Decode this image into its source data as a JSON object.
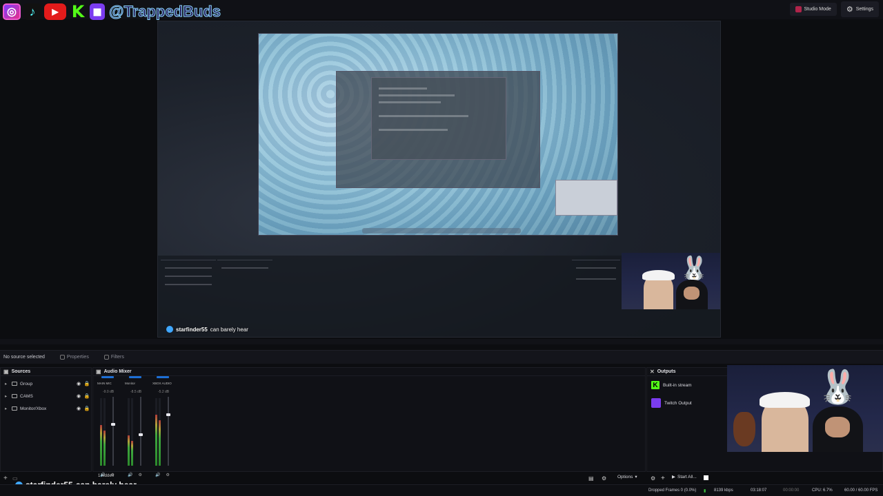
{
  "topbar": {
    "handle": "@TrappedBuds",
    "tiktok_icon": "tiktok-icon",
    "social_icons": [
      "instagram-icon",
      "tiktok-icon",
      "youtube-icon",
      "kick-icon",
      "twitch-icon"
    ],
    "studio_mode_label": "Studio Mode",
    "settings_label": "Settings"
  },
  "preview": {
    "chat_user": "starfinder55",
    "chat_text": "can barely hear"
  },
  "selection_bar": {
    "no_source": "No source selected",
    "properties": "Properties",
    "filters": "Filters"
  },
  "sources": {
    "title": "Sources",
    "items": [
      {
        "label": "Group"
      },
      {
        "label": "CAMS"
      },
      {
        "label": "Monitor/Xbox"
      }
    ]
  },
  "mixer": {
    "title": "Audio Mixer",
    "channels": [
      {
        "name": "MAIN MIC",
        "db": "-9.0 dB",
        "level": 0.6
      },
      {
        "name": "Monitor",
        "db": "-8.5 dB",
        "level": 0.45
      },
      {
        "name": "XBOX AUDIO",
        "db": "-5.2 dB",
        "level": 0.75
      }
    ],
    "hidden_label": "1 hidden"
  },
  "outputs": {
    "title": "Outputs",
    "items": [
      {
        "label": "Built-in stream"
      },
      {
        "label": "Twitch Output"
      }
    ]
  },
  "controls": {
    "options_label": "Options",
    "start_all_label": "Start All..."
  },
  "status": {
    "dropped_frames": "Dropped Frames 0 (0.0%)",
    "bitrate": "8139 kbps",
    "stream_time": "03:18:07",
    "rec_time": "00:00:00",
    "cpu": "CPU: 6.7%",
    "fps": "60.00 / 60.00 FPS"
  },
  "chat_overlay": {
    "user": "starfinder55",
    "text": "can barely hear"
  },
  "colors": {
    "kick": "#53fc18",
    "twitch": "#7b3cf0",
    "youtube": "#e31b1b",
    "accent_blue": "#1d6fd6"
  }
}
